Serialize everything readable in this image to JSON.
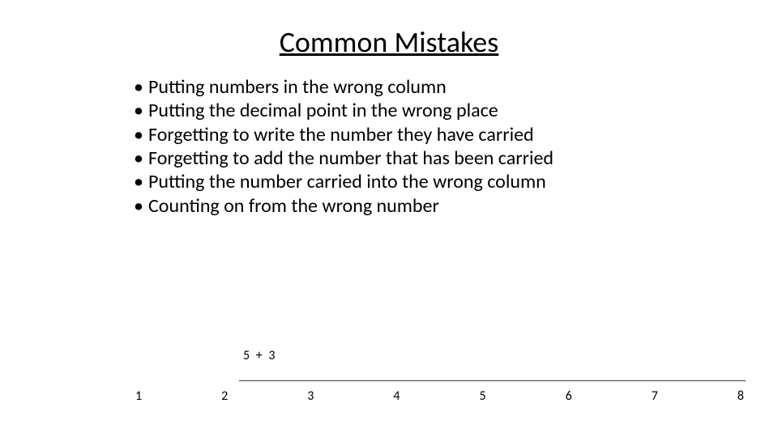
{
  "title": "Common Mistakes",
  "bullets": [
    "Putting numbers in the wrong column",
    "Putting the decimal point in the wrong place",
    "Forgetting to write the number they have carried",
    "Forgetting to add the number that has been carried",
    "Putting the number carried into the wrong column",
    "Counting on from the wrong number"
  ],
  "diagram": {
    "expression": "5 + 3",
    "numbers": [
      "1",
      "2",
      "3",
      "4",
      "5",
      "6",
      "7",
      "8"
    ]
  }
}
